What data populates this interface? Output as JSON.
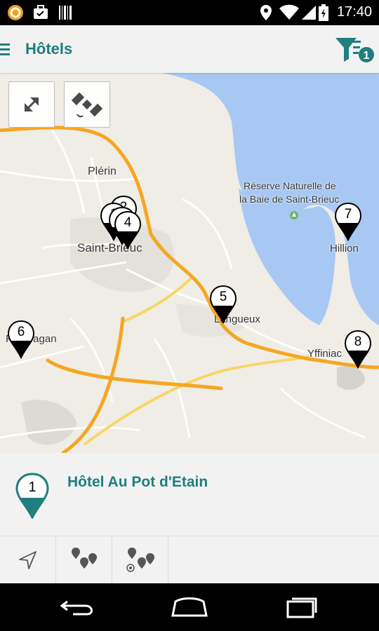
{
  "status_bar": {
    "time": "17:40",
    "left_icons": [
      "app-notification-icon",
      "briefcase-icon",
      "barcode-icon"
    ],
    "right_icons": [
      "location-pin-icon",
      "wifi-icon",
      "cell-signal-icon",
      "battery-icon"
    ]
  },
  "app_bar": {
    "title": "Hôtels",
    "filter_badge": "1"
  },
  "map": {
    "controls": [
      "fullscreen-icon",
      "satellite-icon"
    ],
    "labels": {
      "plerin": "Plérin",
      "saint_brieuc": "Saint-Brieuc",
      "reserve_line1": "Réserve Naturelle de",
      "reserve_line2": "la Baie de Saint-Brieuc",
      "hillion": "Hillion",
      "langueux": "Langueux",
      "ploufragan": "Ploufragan",
      "yffiniac": "Yffiniac"
    },
    "markers": [
      "1",
      "2",
      "3",
      "4",
      "5",
      "6",
      "7",
      "8"
    ]
  },
  "selected_hotel": {
    "number": "1",
    "name": "Hôtel Au Pot d'Etain"
  },
  "bottom_toolbar": {
    "tools": [
      "navigate-icon",
      "all-markers-icon",
      "markers-near-me-icon"
    ]
  },
  "nav_bar": {
    "buttons": [
      "back-icon",
      "home-icon",
      "recent-apps-icon"
    ]
  },
  "colors": {
    "accent": "#1f7f7d",
    "water": "#a8c8f4",
    "land": "#f0ede6",
    "highway": "#f5a623",
    "secondary_road": "#f7d668"
  }
}
